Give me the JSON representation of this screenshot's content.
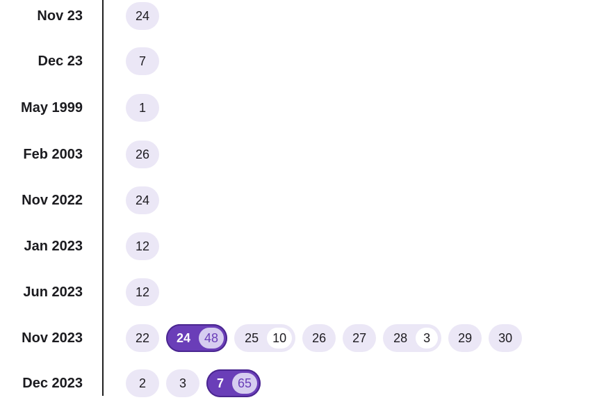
{
  "timeline": {
    "rows": [
      {
        "label": "Nov 23",
        "chips": [
          {
            "day": "24"
          }
        ]
      },
      {
        "label": "Dec 23",
        "chips": [
          {
            "day": "7"
          }
        ]
      },
      {
        "label": "May 1999",
        "chips": [
          {
            "day": "1"
          }
        ]
      },
      {
        "label": "Feb 2003",
        "chips": [
          {
            "day": "26"
          }
        ]
      },
      {
        "label": "Nov 2022",
        "chips": [
          {
            "day": "24"
          }
        ]
      },
      {
        "label": "Jan 2023",
        "chips": [
          {
            "day": "12"
          }
        ]
      },
      {
        "label": "Jun 2023",
        "chips": [
          {
            "day": "12"
          }
        ]
      },
      {
        "label": "Nov 2023",
        "chips": [
          {
            "day": "22"
          },
          {
            "day": "24",
            "count": "48",
            "selected": true
          },
          {
            "day": "25",
            "count": "10"
          },
          {
            "day": "26"
          },
          {
            "day": "27"
          },
          {
            "day": "28",
            "count": "3"
          },
          {
            "day": "29"
          },
          {
            "day": "30"
          }
        ]
      },
      {
        "label": "Dec 2023",
        "chips": [
          {
            "day": "2"
          },
          {
            "day": "3"
          },
          {
            "day": "7",
            "count": "65",
            "selected": true
          }
        ]
      }
    ]
  },
  "colors": {
    "chip_background": "#ebe7f6",
    "chip_selected": "#6a3eb8",
    "count_badge_selected": "#d6cdf0",
    "divider": "#1e1e1e"
  }
}
